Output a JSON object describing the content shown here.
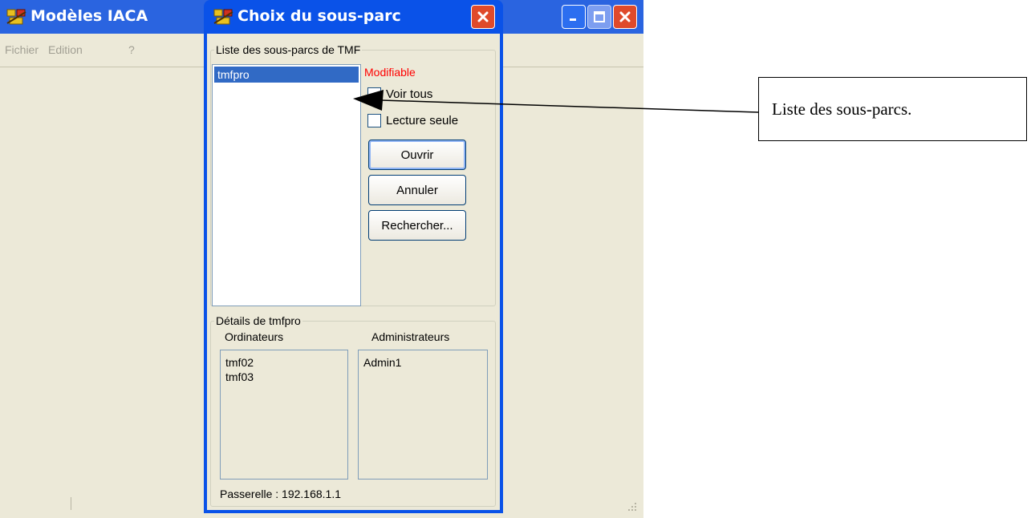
{
  "main_window": {
    "title": "Modèles IACA",
    "menu": [
      "Fichier",
      "Edition",
      "?"
    ]
  },
  "dialog": {
    "title": "Choix du sous-parc",
    "list_group_label": "Liste des sous-parcs de TMF",
    "subparks": [
      "tmfpro"
    ],
    "status_text": "Modifiable",
    "checkbox_show_all": "Voir tous",
    "checkbox_read_only": "Lecture seule",
    "buttons": {
      "open": "Ouvrir",
      "cancel": "Annuler",
      "search": "Rechercher..."
    },
    "details": {
      "group_label": "Détails de tmfpro",
      "computers_header": "Ordinateurs",
      "admins_header": "Administrateurs",
      "computers": [
        "tmf02",
        "tmf03"
      ],
      "admins": [
        "Admin1"
      ],
      "gateway": "Passerelle : 192.168.1.1"
    }
  },
  "annotation": {
    "text": "Liste des sous-parcs."
  },
  "colors": {
    "xp_titlebar_blue": "#0a52e8",
    "xp_face": "#ece9d8",
    "selection_blue": "#316ac5",
    "status_red": "#ff0000",
    "close_red": "#df4a2b"
  }
}
